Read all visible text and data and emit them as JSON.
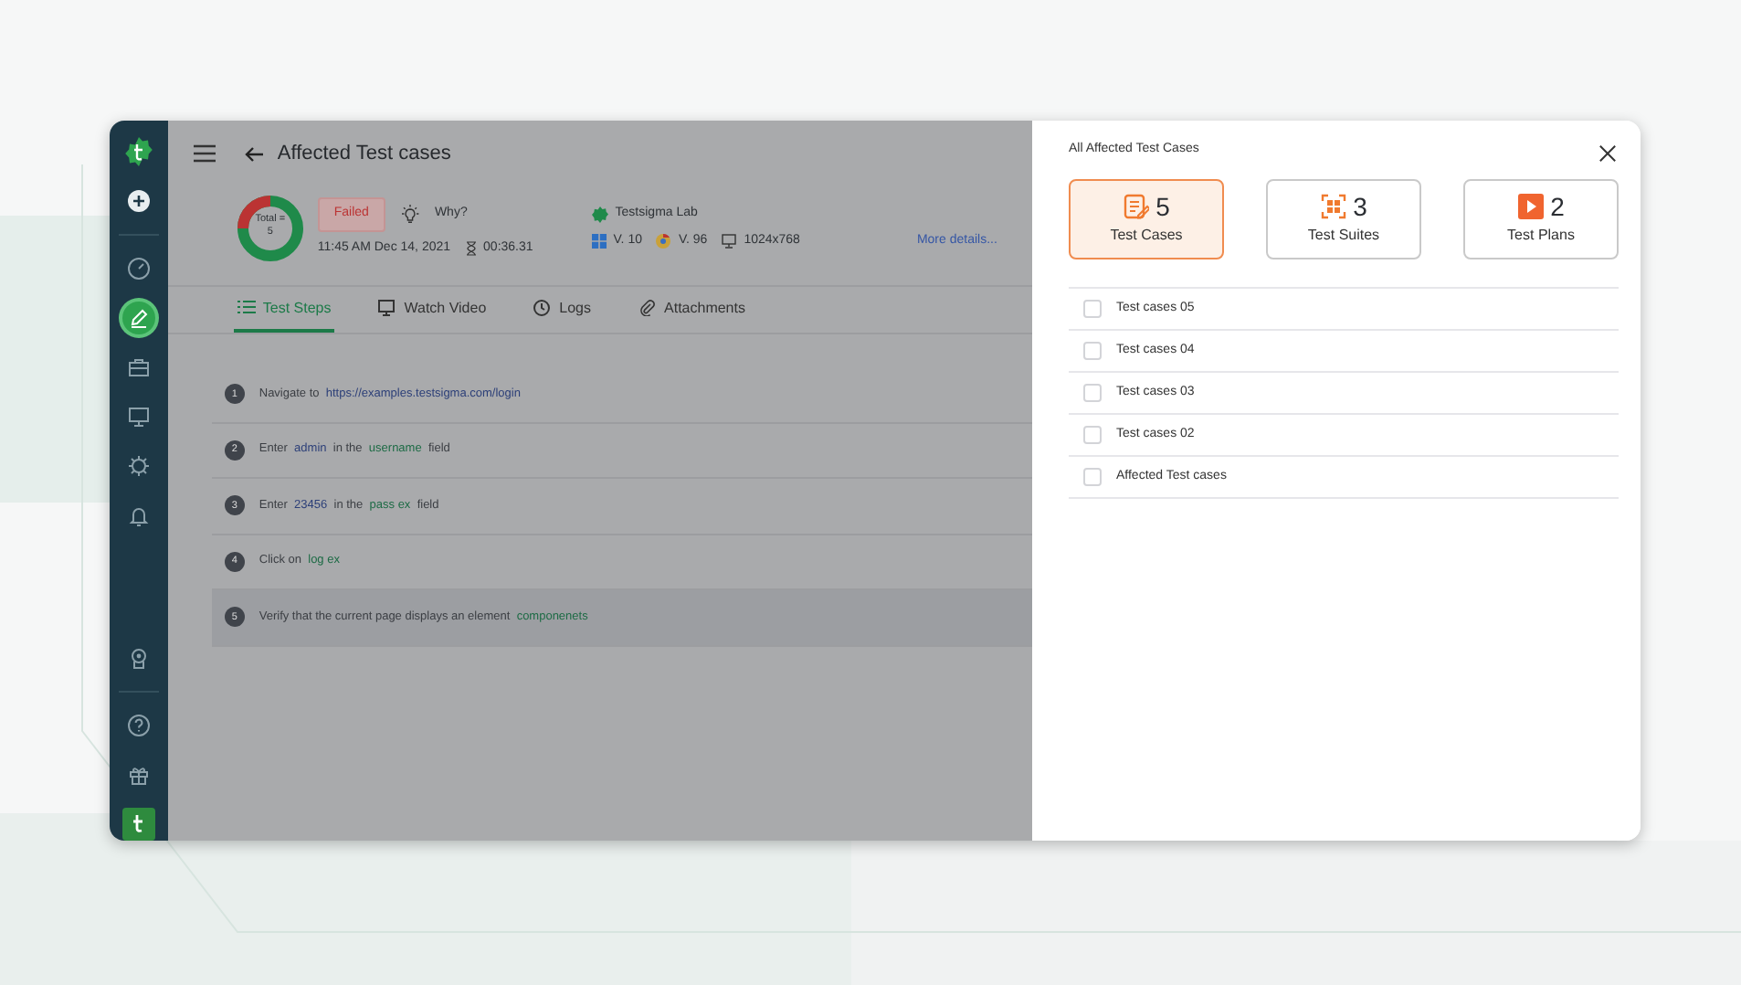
{
  "sidebar": {
    "items": [
      {
        "selected": false
      },
      {
        "selected": false
      },
      {
        "selected": false
      },
      {
        "selected": true
      },
      {
        "selected": false
      },
      {
        "selected": false
      },
      {
        "selected": false
      },
      {
        "selected": false
      },
      {
        "selected": false
      },
      {
        "selected": false
      },
      {
        "selected": false
      },
      {
        "selected": false
      }
    ]
  },
  "header": {
    "title": "Affected Test cases",
    "donut_label": [
      "Total =",
      "5"
    ],
    "status": "Failed",
    "why": "Why?",
    "datetime": "11:45 AM Dec 14, 2021",
    "duration": "00:36.31",
    "lab": "Testsigma Lab",
    "os_version": "V. 10",
    "browser_version": "V. 96",
    "resolution": "1024x768",
    "more_details": "More details..."
  },
  "tabs": [
    {
      "label": "Test Steps",
      "selected": true
    },
    {
      "label": "Watch Video",
      "selected": false
    },
    {
      "label": "Logs",
      "selected": false
    },
    {
      "label": "Attachments",
      "selected": false
    }
  ],
  "steps": [
    {
      "number": "1",
      "selected": false,
      "parts": [
        {
          "kind": "plain",
          "text": "Navigate to"
        },
        {
          "kind": "data",
          "text": "https://examples.testsigma.com/login"
        }
      ]
    },
    {
      "number": "2",
      "selected": false,
      "parts": [
        {
          "kind": "plain",
          "text": "Enter"
        },
        {
          "kind": "data",
          "text": "admin"
        },
        {
          "kind": "plain",
          "text": "in the"
        },
        {
          "kind": "element",
          "text": "username"
        },
        {
          "kind": "plain",
          "text": "field"
        }
      ]
    },
    {
      "number": "3",
      "selected": false,
      "parts": [
        {
          "kind": "plain",
          "text": "Enter"
        },
        {
          "kind": "data",
          "text": "23456"
        },
        {
          "kind": "plain",
          "text": "in the"
        },
        {
          "kind": "element",
          "text": "pass ex"
        },
        {
          "kind": "plain",
          "text": "field"
        }
      ]
    },
    {
      "number": "4",
      "selected": false,
      "parts": [
        {
          "kind": "plain",
          "text": "Click on"
        },
        {
          "kind": "element",
          "text": "log ex"
        }
      ]
    },
    {
      "number": "5",
      "selected": true,
      "parts": [
        {
          "kind": "plain",
          "text": "Verify that the current page displays an element"
        },
        {
          "kind": "element",
          "text": "componenets"
        }
      ]
    }
  ],
  "panel": {
    "title": "All Affected Test Cases",
    "summary": [
      {
        "kind": "cases",
        "count": "5",
        "label": "Test Cases",
        "selected": true
      },
      {
        "kind": "suites",
        "count": "3",
        "label": "Test Suites",
        "selected": false
      },
      {
        "kind": "plans",
        "count": "2",
        "label": "Test Plans",
        "selected": false
      }
    ],
    "items": [
      {
        "label": "Test cases 05",
        "checked": false
      },
      {
        "label": "Test cases 04",
        "checked": false
      },
      {
        "label": "Test cases 03",
        "checked": false
      },
      {
        "label": "Test cases 02",
        "checked": false
      },
      {
        "label": "Affected Test cases",
        "checked": false
      }
    ]
  }
}
